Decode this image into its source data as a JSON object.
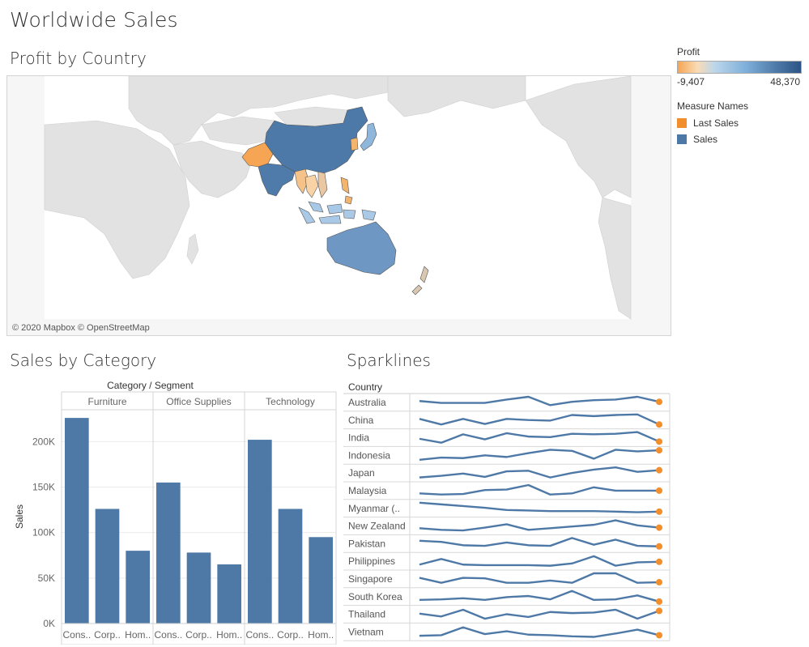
{
  "dashboard": {
    "title": "Worldwide Sales"
  },
  "map": {
    "title": "Profit by Country",
    "credit": "© 2020 Mapbox © OpenStreetMap",
    "countries": [
      {
        "name": "China",
        "color": "#4d79a8"
      },
      {
        "name": "India",
        "color": "#4f7bab"
      },
      {
        "name": "Pakistan",
        "color": "#f5a553"
      },
      {
        "name": "Australia",
        "color": "#6e97c3"
      },
      {
        "name": "Japan",
        "color": "#8fb7dc"
      },
      {
        "name": "South Korea",
        "color": "#f3b56e"
      },
      {
        "name": "Myanmar",
        "color": "#f5c28a"
      },
      {
        "name": "Thailand",
        "color": "#f9d2a6"
      },
      {
        "name": "Vietnam",
        "color": "#e9c7a3"
      },
      {
        "name": "Malaysia",
        "color": "#a7c8e6"
      },
      {
        "name": "Indonesia",
        "color": "#a9c9e7"
      },
      {
        "name": "Philippines",
        "color": "#f3b56e"
      },
      {
        "name": "New Zealand",
        "color": "#d9c7b0"
      }
    ]
  },
  "legend": {
    "profit_title": "Profit",
    "profit_min": "-9,407",
    "profit_max": "48,370",
    "measure_title": "Measure Names",
    "items": [
      {
        "label": "Last Sales",
        "color": "#f28e2b"
      },
      {
        "label": "Sales",
        "color": "#4e79a7"
      }
    ]
  },
  "category": {
    "title": "Sales by Category",
    "chart_data": {
      "type": "bar",
      "title": "Category / Segment",
      "ylabel": "Sales",
      "ylim": [
        0,
        235000
      ],
      "yticks": [
        0,
        50000,
        100000,
        150000,
        200000
      ],
      "ytick_labels": [
        "0K",
        "50K",
        "100K",
        "150K",
        "200K"
      ],
      "groups": [
        {
          "name": "Furniture",
          "segments": [
            "Cons..",
            "Corp..",
            "Hom.."
          ],
          "values": [
            226000,
            126000,
            80000
          ]
        },
        {
          "name": "Office Supplies",
          "segments": [
            "Cons..",
            "Corp..",
            "Hom.."
          ],
          "values": [
            155000,
            78000,
            65000
          ]
        },
        {
          "name": "Technology",
          "segments": [
            "Cons..",
            "Corp..",
            "Hom.."
          ],
          "values": [
            202000,
            126000,
            95000
          ]
        }
      ],
      "color": "#4e79a7"
    }
  },
  "sparklines": {
    "title": "Sparklines",
    "column_header": "Country",
    "chart_data": {
      "type": "line",
      "series_color": "#4e79a7",
      "last_color": "#f28e2b",
      "rows": [
        {
          "country": "Australia",
          "values": [
            0.62,
            0.45,
            0.45,
            0.45,
            0.75,
            1.0,
            0.25,
            0.55,
            0.7,
            0.75,
            1.0,
            0.55
          ]
        },
        {
          "country": "China",
          "values": [
            0.6,
            0.1,
            0.6,
            0.15,
            0.6,
            0.5,
            0.45,
            0.95,
            0.85,
            0.95,
            1.0,
            0.1
          ]
        },
        {
          "country": "India",
          "values": [
            0.4,
            0.05,
            0.8,
            0.35,
            0.9,
            0.6,
            0.55,
            0.85,
            0.8,
            0.85,
            1.0,
            0.15
          ]
        },
        {
          "country": "Indonesia",
          "values": [
            0.1,
            0.3,
            0.25,
            0.5,
            0.35,
            0.7,
            1.0,
            0.9,
            0.2,
            1.0,
            0.85,
            0.95
          ]
        },
        {
          "country": "Japan",
          "values": [
            0.1,
            0.25,
            0.45,
            0.15,
            0.65,
            0.7,
            0.1,
            0.5,
            0.8,
            1.0,
            0.6,
            0.75
          ]
        },
        {
          "country": "Malaysia",
          "values": [
            0.25,
            0.15,
            0.2,
            0.55,
            0.6,
            1.0,
            0.15,
            0.25,
            0.8,
            0.5,
            0.5,
            0.5
          ]
        },
        {
          "country": "Myanmar (..",
          "values": [
            1.0,
            0.85,
            0.7,
            0.55,
            0.35,
            0.3,
            0.25,
            0.25,
            0.25,
            0.2,
            0.15,
            0.2
          ]
        },
        {
          "country": "New Zealand",
          "values": [
            0.3,
            0.15,
            0.1,
            0.35,
            0.65,
            0.15,
            0.3,
            0.45,
            0.6,
            1.0,
            0.55,
            0.35
          ]
        },
        {
          "country": "Pakistan",
          "values": [
            0.75,
            0.65,
            0.35,
            0.3,
            0.6,
            0.35,
            0.3,
            1.0,
            0.4,
            0.85,
            0.3,
            0.25
          ]
        },
        {
          "country": "Philippines",
          "values": [
            0.2,
            0.7,
            0.2,
            0.15,
            0.15,
            0.15,
            0.1,
            0.3,
            0.95,
            0.1,
            0.4,
            0.45
          ]
        },
        {
          "country": "Singapore",
          "values": [
            0.6,
            0.15,
            0.6,
            0.55,
            0.15,
            0.15,
            0.35,
            0.15,
            1.0,
            1.0,
            0.15,
            0.2
          ]
        },
        {
          "country": "South Korea",
          "values": [
            0.2,
            0.25,
            0.35,
            0.2,
            0.45,
            0.55,
            0.25,
            1.0,
            0.2,
            0.25,
            0.6,
            0.05
          ]
        },
        {
          "country": "Thailand",
          "values": [
            0.55,
            0.3,
            0.9,
            0.1,
            0.5,
            0.25,
            0.7,
            0.6,
            0.65,
            0.9,
            0.1,
            0.8
          ]
        },
        {
          "country": "Vietnam",
          "values": [
            0.15,
            0.2,
            0.9,
            0.3,
            0.55,
            0.25,
            0.2,
            0.1,
            0.05,
            0.35,
            0.7,
            0.2
          ]
        }
      ]
    }
  }
}
